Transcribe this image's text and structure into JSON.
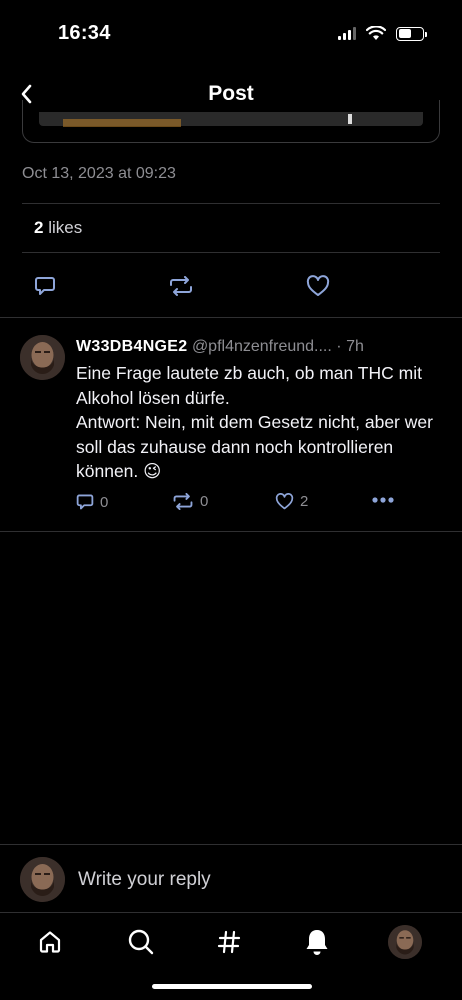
{
  "status_bar": {
    "time": "16:34"
  },
  "header": {
    "title": "Post"
  },
  "post": {
    "date": "Oct 13, 2023 at 09:23",
    "likes_count": "2",
    "likes_label": "likes"
  },
  "reply": {
    "author_name": "W33DB4NGE2",
    "author_handle": "@pfl4nzenfreund....",
    "separator": "·",
    "time_ago": "7h",
    "text": "Eine Frage lautete zb auch, ob man THC mit Alkohol lösen dürfe.\nAntwort: Nein, mit dem Gesetz nicht, aber wer soll das zuhause dann noch kontrollieren können. 😉",
    "reply_count": "0",
    "repost_count": "0",
    "like_count": "2"
  },
  "compose": {
    "placeholder": "Write your reply"
  },
  "colors": {
    "background": "#000000",
    "secondary_text": "#8e8e93",
    "divider": "#2f2f31"
  },
  "icons": {
    "header": [
      "back-chevron-icon"
    ],
    "post_actions": [
      "comment-icon",
      "repost-icon",
      "heart-icon"
    ],
    "reply_actions": [
      "comment-icon",
      "repost-icon",
      "heart-icon",
      "more-icon"
    ],
    "tabs": [
      "home-icon",
      "search-icon",
      "hashtag-icon",
      "notifications-bell-icon",
      "profile-avatar"
    ]
  }
}
